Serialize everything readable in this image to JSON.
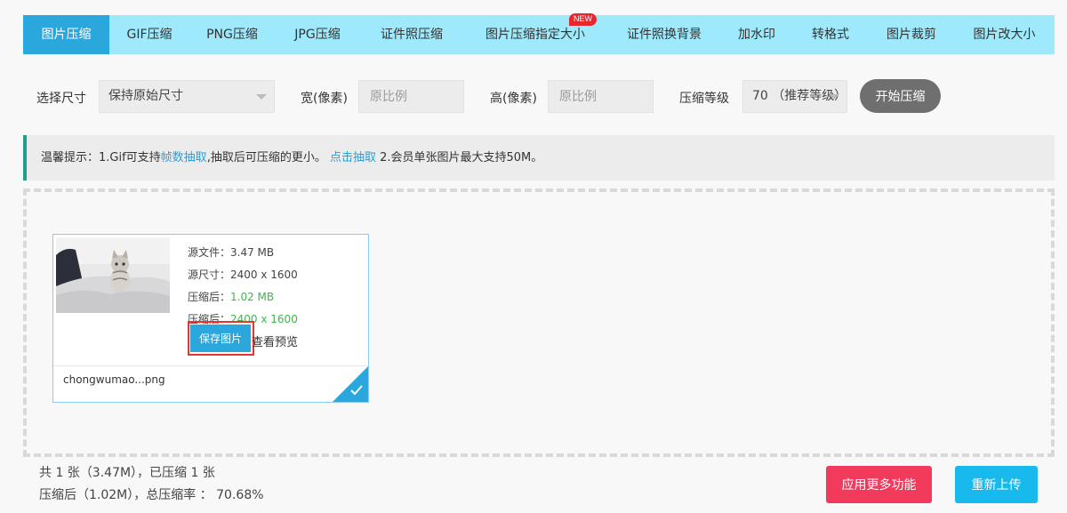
{
  "tabs": [
    {
      "label": "图片压缩",
      "active": true
    },
    {
      "label": "GIF压缩"
    },
    {
      "label": "PNG压缩"
    },
    {
      "label": "JPG压缩"
    },
    {
      "label": "证件照压缩"
    },
    {
      "label": "图片压缩指定大小",
      "badge": "NEW"
    },
    {
      "label": "证件照换背景"
    },
    {
      "label": "加水印"
    },
    {
      "label": "转格式"
    },
    {
      "label": "图片裁剪"
    },
    {
      "label": "图片改大小"
    }
  ],
  "settings": {
    "size_label": "选择尺寸",
    "size_value": "保持原始尺寸",
    "width_label": "宽(像素)",
    "width_placeholder": "原比例",
    "height_label": "高(像素)",
    "height_placeholder": "原比例",
    "level_label": "压缩等级",
    "level_value": "70 （推荐等级）",
    "start_button": "开始压缩"
  },
  "tip": {
    "prefix": "温馨提示：1.Gif可支持",
    "link1": "帧数抽取",
    "middle": ",抽取后可压缩的更小。 ",
    "link2": "点击抽取",
    "suffix": " 2.会员单张图片最大支持50M。"
  },
  "file": {
    "source_file": "源文件：3.47 MB",
    "source_size": "源尺寸：2400 x 1600",
    "compressed_file_label": "压缩后：",
    "compressed_file_value": "1.02 MB",
    "compressed_size_label": "压缩后：",
    "compressed_size_value": "2400 x 1600",
    "save_button": "保存图片",
    "preview_link": "查看预览",
    "filename": "chongwumao...png"
  },
  "stats": {
    "line1": "共 1 张（3.47M），已压缩 1 张",
    "line2": "压缩后（1.02M），总压缩率 ： 70.68%"
  },
  "buttons": {
    "more_features": "应用更多功能",
    "reupload": "重新上传"
  },
  "colors": {
    "tab_bar": "#9ee9fb",
    "tab_active": "#2aa7dc",
    "accent_green": "#3cb84a",
    "highlight_red": "#e8352f",
    "more_button": "#f23a5c",
    "reupload_button": "#18b9ec"
  }
}
